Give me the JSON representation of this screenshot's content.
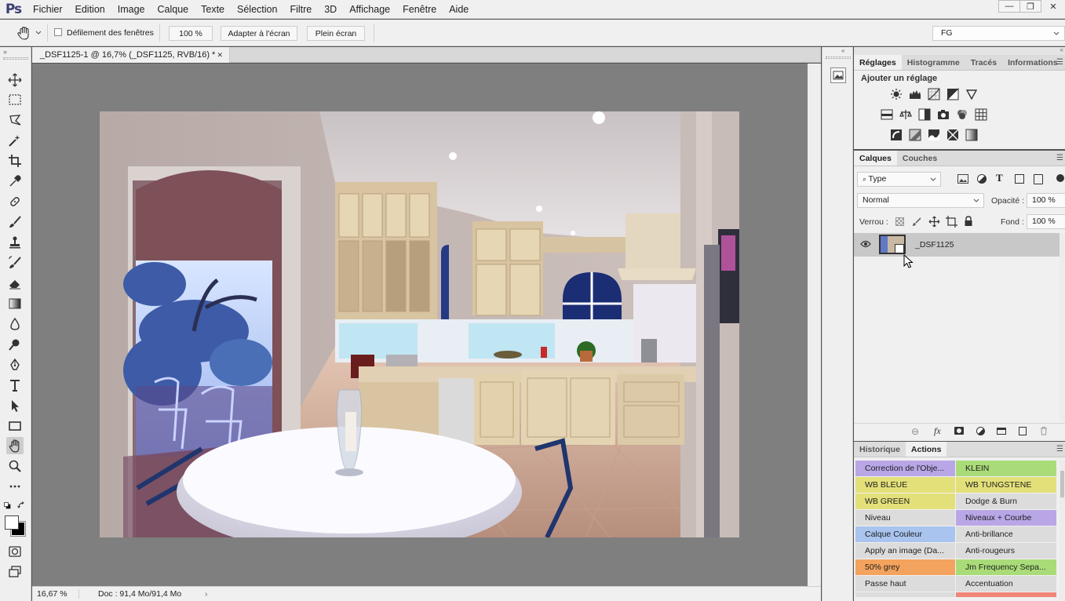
{
  "app": {
    "logo": "Ps"
  },
  "menu": [
    "Fichier",
    "Edition",
    "Image",
    "Calque",
    "Texte",
    "Sélection",
    "Filtre",
    "3D",
    "Affichage",
    "Fenêtre",
    "Aide"
  ],
  "window_controls": {
    "minimize": "—",
    "restore": "❐",
    "close": "✕"
  },
  "options": {
    "scroll_all_windows": "Défilement des fenêtres",
    "zoom_value": "100 %",
    "fit_screen": "Adapter à l'écran",
    "full_screen": "Plein écran",
    "workspace": "FG"
  },
  "document": {
    "tab_title": "_DSF1125-1 @ 16,7% (_DSF1125, RVB/16) *",
    "tab_close": "✕",
    "zoom_status": "16,67 %",
    "doc_info": "Doc : 91,4 Mo/91,4 Mo"
  },
  "adjustments_panel": {
    "tabs": [
      "Réglages",
      "Histogramme",
      "Tracés",
      "Informations"
    ],
    "add_label": "Ajouter un réglage"
  },
  "layers_panel": {
    "tabs": [
      "Calques",
      "Couches"
    ],
    "filter_type": "Type",
    "blend_mode": "Normal",
    "opacity_label": "Opacité :",
    "opacity_value": "100 %",
    "lock_label": "Verrou :",
    "fill_label": "Fond :",
    "fill_value": "100 %",
    "layer_name": "_DSF1125"
  },
  "actions_panel": {
    "tabs": [
      "Historique",
      "Actions"
    ],
    "buttons": [
      {
        "label": "Correction de l'Obje...",
        "color": "#b9a6e6"
      },
      {
        "label": "KLEIN",
        "color": "#a9dc78"
      },
      {
        "label": "WB BLEUE",
        "color": "#e3e07a"
      },
      {
        "label": "WB TUNGSTENE",
        "color": "#e3e07a"
      },
      {
        "label": "WB GREEN",
        "color": "#e3e07a"
      },
      {
        "label": "Dodge & Burn",
        "color": "#dcdcdc"
      },
      {
        "label": "Niveau",
        "color": "#dcdcdc"
      },
      {
        "label": "Niveaux + Courbe",
        "color": "#b9a6e6"
      },
      {
        "label": "Calque Couleur",
        "color": "#a8c4ef"
      },
      {
        "label": "Anti-brillance",
        "color": "#dcdcdc"
      },
      {
        "label": "Apply an image (Da...",
        "color": "#dcdcdc"
      },
      {
        "label": "Anti-rougeurs",
        "color": "#dcdcdc"
      },
      {
        "label": "50% grey",
        "color": "#f4a35e"
      },
      {
        "label": "Jm Frequency Sepa...",
        "color": "#a9dc78"
      },
      {
        "label": "Passe haut",
        "color": "#dcdcdc"
      },
      {
        "label": "Accentuation",
        "color": "#dcdcdc"
      }
    ]
  },
  "colors": {
    "foreground": "#ffffff",
    "background": "#000000"
  }
}
